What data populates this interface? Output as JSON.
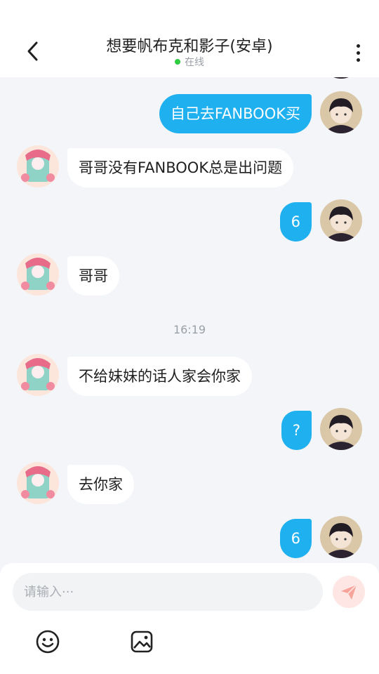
{
  "header": {
    "title": "想要帆布克和影子(安卓)",
    "status": "在线",
    "back_icon": "chevron-left-icon",
    "more_icon": "more-vertical-icon"
  },
  "messages": [
    {
      "side": "out",
      "text": "自己去FANBOOK买"
    },
    {
      "side": "in",
      "text": "哥哥没有FANBOOK总是出问题"
    },
    {
      "side": "out",
      "text": "6"
    },
    {
      "side": "in",
      "text": "哥哥"
    },
    {
      "side": "in",
      "text": "不给妹妹的话人家会你家"
    },
    {
      "side": "out",
      "text": "?"
    },
    {
      "side": "in",
      "text": "去你家"
    },
    {
      "side": "out",
      "text": "6"
    }
  ],
  "timestamp": "16:19",
  "composer": {
    "placeholder": "请输入···",
    "send_icon": "send-icon",
    "emoji_icon": "emoji-icon",
    "image_icon": "image-icon"
  },
  "colors": {
    "outgoing_bubble": "#1fb0f0",
    "incoming_bubble": "#ffffff",
    "background": "#f3f5f8",
    "online_dot": "#2ecc40"
  }
}
